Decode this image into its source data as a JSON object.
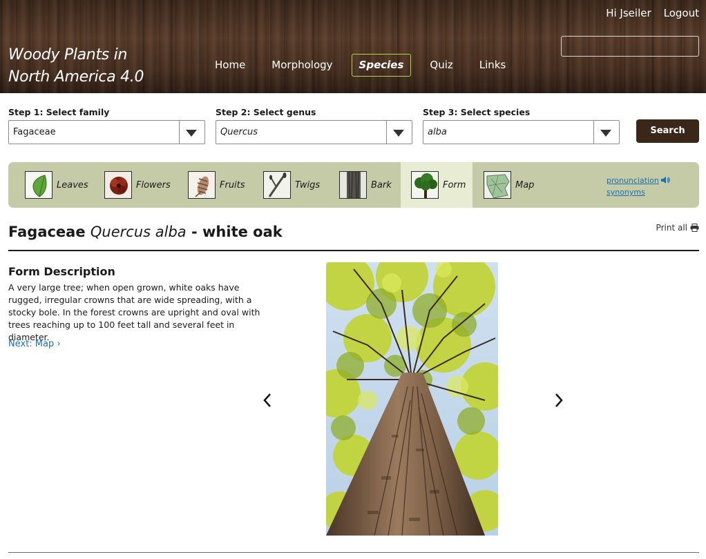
{
  "header": {
    "site_title_line1": "Woody Plants in",
    "site_title_line2": "North America 4.0",
    "greeting": "Hi Jseiler",
    "logout": "Logout",
    "search_value": "",
    "nav": [
      {
        "label": "Home"
      },
      {
        "label": "Morphology"
      },
      {
        "label": "Species",
        "active": true
      },
      {
        "label": "Quiz"
      },
      {
        "label": "Links"
      }
    ]
  },
  "steps": {
    "family": {
      "label": "Step 1: Select family",
      "value": "Fagaceae"
    },
    "genus": {
      "label": "Step 2: Select genus",
      "value": "Quercus"
    },
    "species": {
      "label": "Step 3: Select species",
      "value": "alba"
    },
    "search_label": "Search"
  },
  "tabs": [
    {
      "label": "Leaves",
      "icon": "leaf-icon"
    },
    {
      "label": "Flowers",
      "icon": "flower-icon"
    },
    {
      "label": "Fruits",
      "icon": "fruit-icon"
    },
    {
      "label": "Twigs",
      "icon": "twig-icon"
    },
    {
      "label": "Bark",
      "icon": "bark-icon"
    },
    {
      "label": "Form",
      "icon": "tree-form-icon",
      "active": true
    },
    {
      "label": "Map",
      "icon": "map-icon"
    }
  ],
  "tab_links": {
    "pronunciation": "pronunciation",
    "synonyms": "synonyms"
  },
  "species": {
    "family": "Fagaceae",
    "scientific": "Quercus alba",
    "common": "- white oak",
    "print_all": "Print all"
  },
  "description": {
    "title": "Form Description",
    "text": "A very large tree; when open grown, white oaks have rugged, irregular crowns that are wide spreading, with a stocky bole. In the forest crowns are upright and oval with trees reaching up to 100 feet tall and several feet in diameter.",
    "next_link": "Next: Map ›"
  },
  "colors": {
    "accent_link": "#1a6fb3",
    "tabbar_bg": "#c5cba7",
    "tab_active_bg": "#e7ecd2",
    "search_button_bg": "#3b271a",
    "active_nav_border": "#b9d24a"
  }
}
